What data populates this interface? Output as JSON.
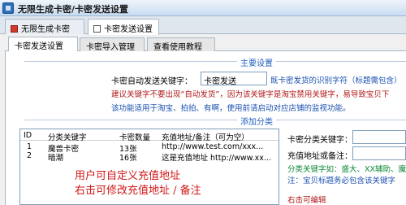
{
  "window": {
    "title": "无限生成卡密/卡密发送设置"
  },
  "outer_tabs": [
    {
      "label": "无限生成卡密",
      "icon": "red-square-icon"
    },
    {
      "label": "卡密发送设置",
      "icon": "box-icon"
    }
  ],
  "inner_tabs": [
    {
      "label": "卡密发送设置"
    },
    {
      "label": "卡密导入管理"
    },
    {
      "label": "查看使用教程"
    }
  ],
  "main_settings": {
    "heading": "主要设置",
    "keyword_label": "卡密自动发送关键字：",
    "keyword_value": "卡密发送",
    "keyword_note": "既卡密发货的识别字符（标题需包含）",
    "tip_line1_red": "建议关键字不要出现“自动发货”，因为该关键字是淘宝禁用关键字，易导致宝贝下",
    "tip_line2_blue": "该功能适用于淘宝、拍拍、有啊，使用前请启动对应店铺的监视功能。"
  },
  "add_category": {
    "heading": "添加分类",
    "columns": [
      "ID",
      "分类关键字",
      "卡密数量",
      "充值地址/备注（可为空）"
    ],
    "rows": [
      {
        "id": "1",
        "keyword": "魔兽卡密",
        "count": "13张",
        "address": "http://www.test.com/xxx..."
      },
      {
        "id": "2",
        "keyword": "暗潮",
        "count": "16张",
        "address": "这是充值地址 http://www.xx..."
      }
    ],
    "cat_keyword_label": "卡密分类关键字：",
    "recharge_label": "充值地址或备注：",
    "example_note": "分类关键字如：盛大、XX辅助、魔兽",
    "title_note": "注：宝贝标题务必包含该关键字",
    "right_click_note": "右击可编辑"
  },
  "overlay": {
    "line1": "用户可自定义充值地址",
    "line2": "右击可修改充值地址 / 备注"
  }
}
